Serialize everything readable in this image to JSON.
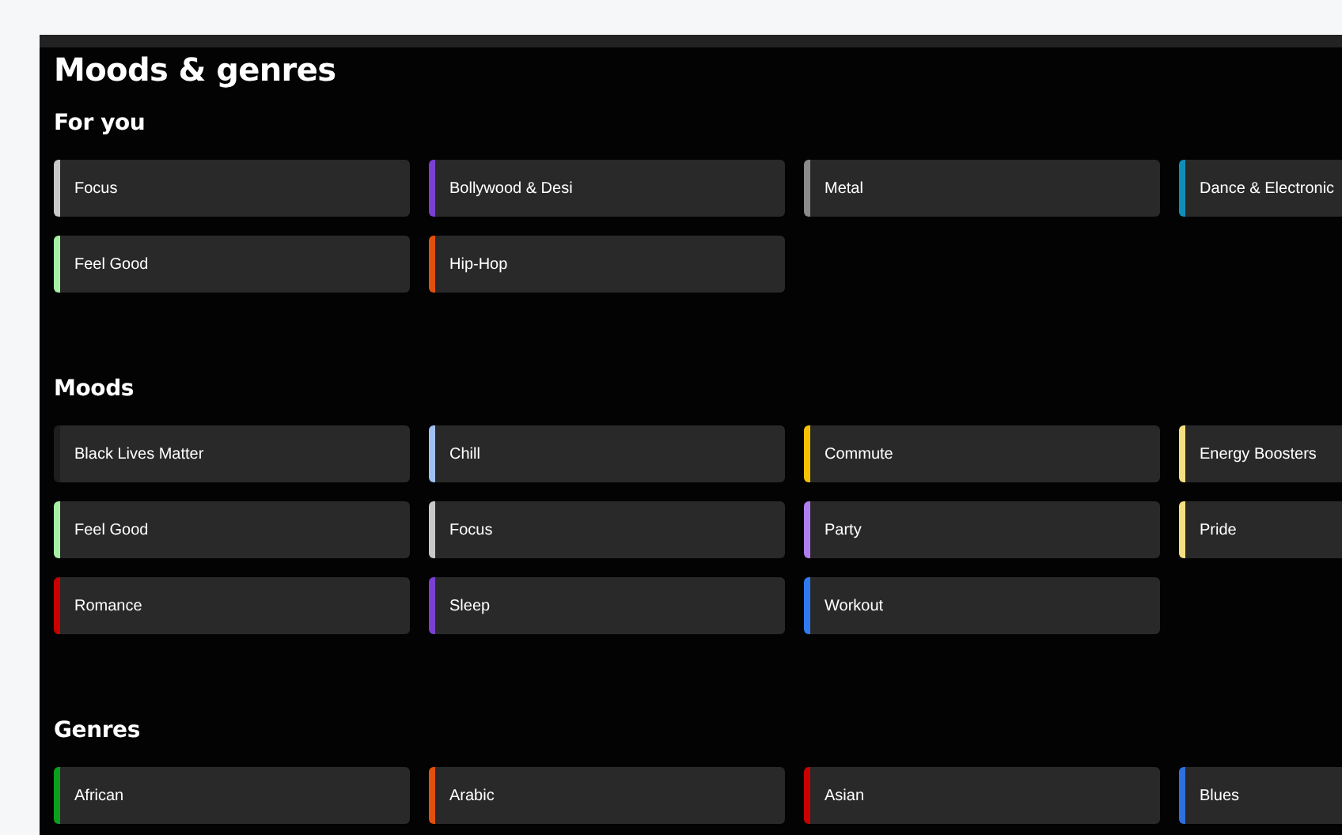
{
  "title": "Moods & genres",
  "sections": [
    {
      "heading": "For you",
      "tiles": [
        {
          "label": "Focus",
          "color": "#c8c8c8"
        },
        {
          "label": "Bollywood & Desi",
          "color": "#7b3fd1"
        },
        {
          "label": "Metal",
          "color": "#8a8a8a"
        },
        {
          "label": "Dance & Electronic",
          "color": "#0f8fb8"
        },
        {
          "label": "Feel Good",
          "color": "#a6f0a6"
        },
        {
          "label": "Hip-Hop",
          "color": "#e0500f"
        }
      ]
    },
    {
      "heading": "Moods",
      "tiles": [
        {
          "label": "Black Lives Matter",
          "color": "#1e1e1e"
        },
        {
          "label": "Chill",
          "color": "#9fc0f0"
        },
        {
          "label": "Commute",
          "color": "#f5c000"
        },
        {
          "label": "Energy Boosters",
          "color": "#f5df80"
        },
        {
          "label": "Feel Good",
          "color": "#a6f0a6"
        },
        {
          "label": "Focus",
          "color": "#c8c8c8"
        },
        {
          "label": "Party",
          "color": "#b07ef0"
        },
        {
          "label": "Pride",
          "color": "#f5df80"
        },
        {
          "label": "Romance",
          "color": "#c80000"
        },
        {
          "label": "Sleep",
          "color": "#7b3fd1"
        },
        {
          "label": "Workout",
          "color": "#2f7af0"
        }
      ]
    },
    {
      "heading": "Genres",
      "tiles": [
        {
          "label": "African",
          "color": "#0aa01e"
        },
        {
          "label": "Arabic",
          "color": "#e0500f"
        },
        {
          "label": "Asian",
          "color": "#c80000"
        },
        {
          "label": "Blues",
          "color": "#2f6fe0"
        }
      ]
    }
  ]
}
